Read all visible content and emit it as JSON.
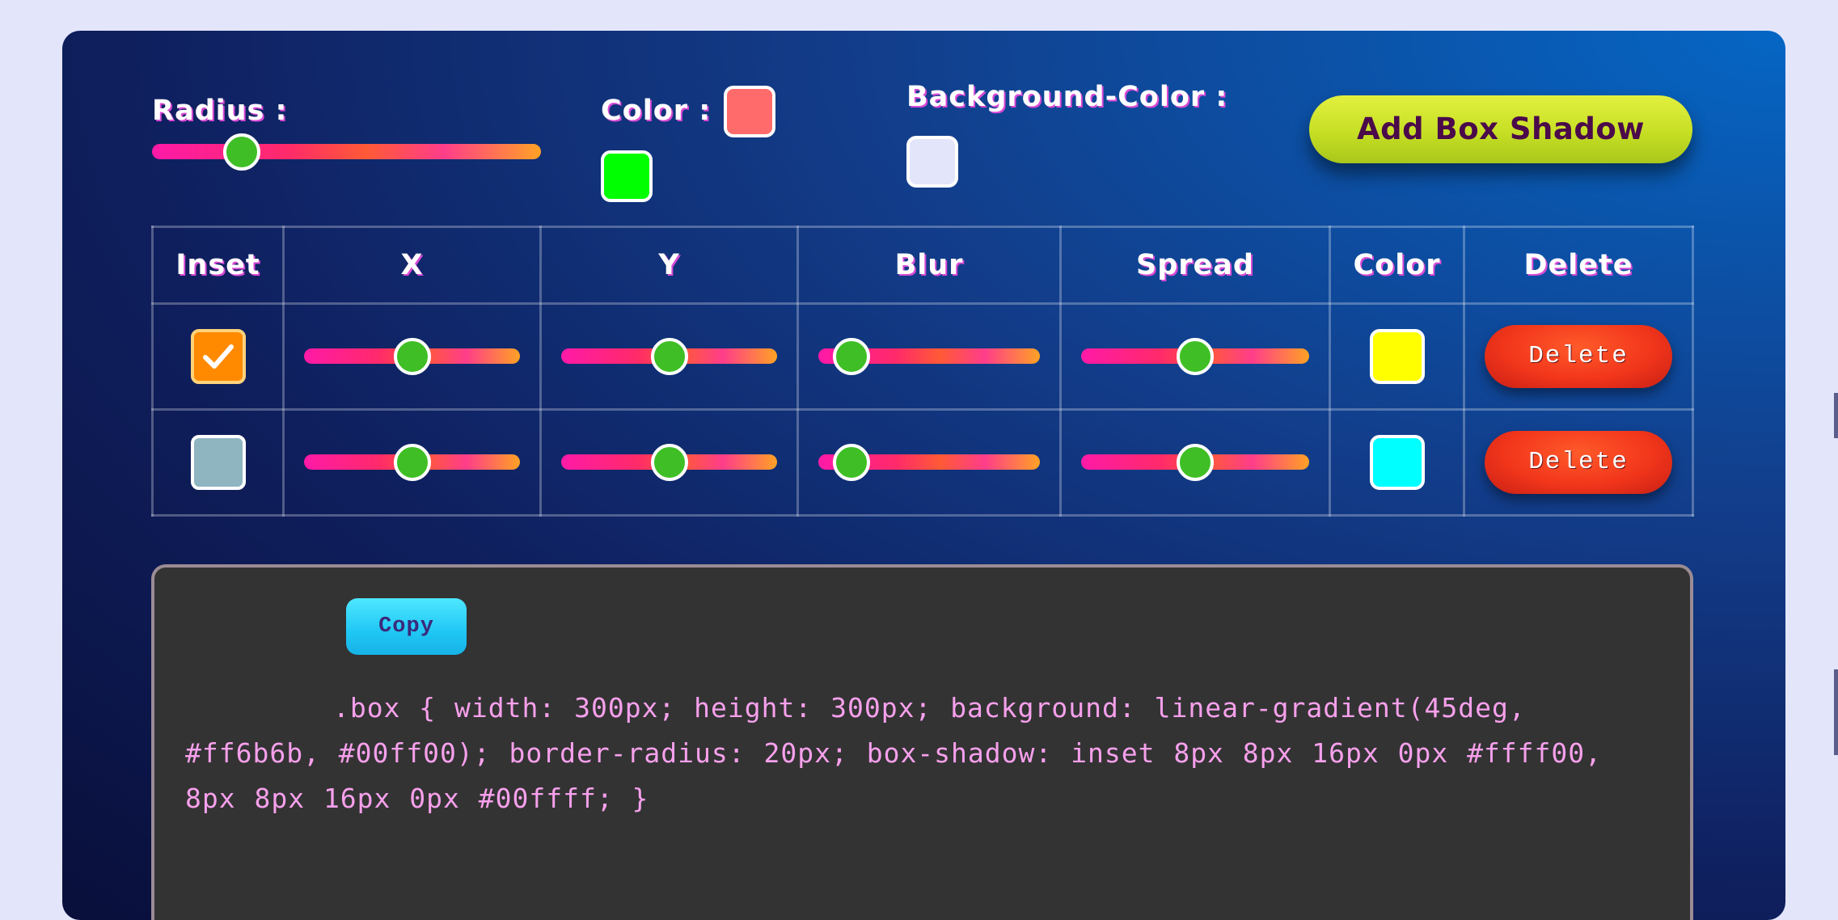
{
  "controls": {
    "radius_label": "Radius :",
    "radius_value": 0.23,
    "color_label": "Color :",
    "color_1": "#ff6b6b",
    "color_2": "#00ff00",
    "bg_color_label": "Background-Color :",
    "bg_color": "#e3e6fb",
    "add_button": "Add Box Shadow"
  },
  "table": {
    "headers": [
      "Inset",
      "X",
      "Y",
      "Blur",
      "Spread",
      "Color",
      "Delete"
    ],
    "rows": [
      {
        "inset": true,
        "x_value": 0.5,
        "y_value": 0.5,
        "blur_value": 0.15,
        "spread_value": 0.5,
        "color": "#ffff00",
        "delete_label": "Delete"
      },
      {
        "inset": false,
        "x_value": 0.5,
        "y_value": 0.5,
        "blur_value": 0.15,
        "spread_value": 0.5,
        "color": "#00ffff",
        "delete_label": "Delete"
      }
    ]
  },
  "code_panel": {
    "copy_label": "Copy",
    "code": "        .box { width: 300px; height: 300px; background: linear-gradient(45deg, #ff6b6b, #00ff00); border-radius: 20px; box-shadow: inset 8px 8px 16px 0px #ffff00,  8px 8px 16px 0px #00ffff; }"
  }
}
